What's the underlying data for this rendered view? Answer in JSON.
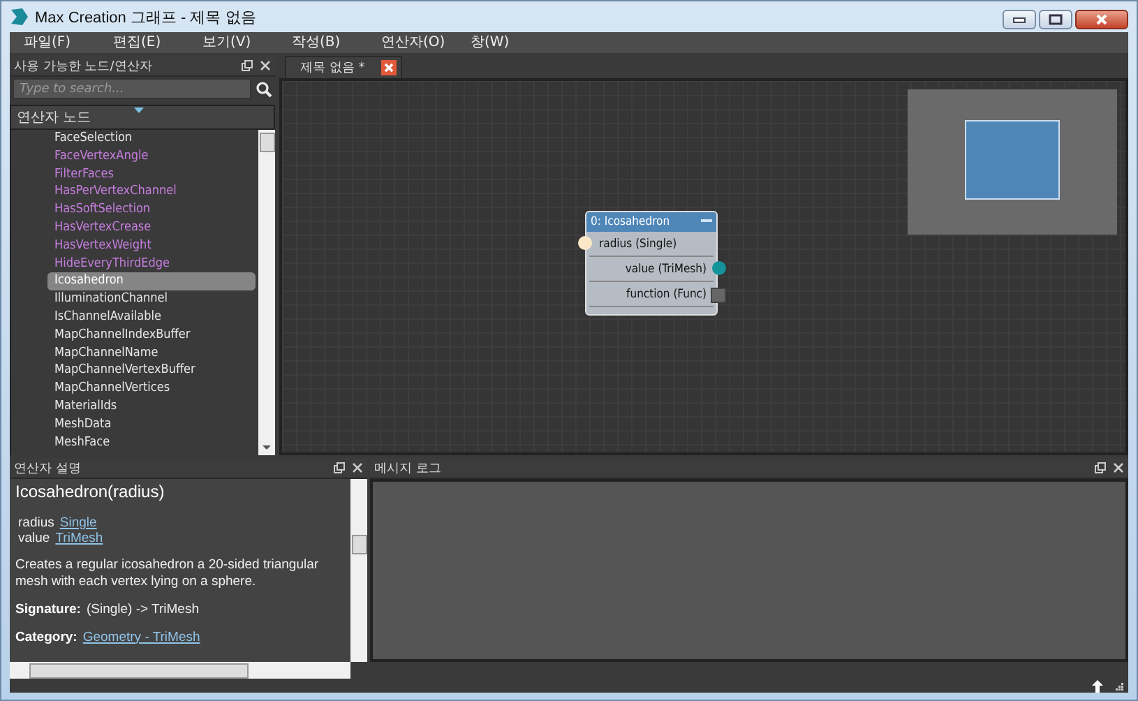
{
  "window": {
    "title": "Max Creation 그래프 - 제목 없음"
  },
  "menu": [
    "파일(F)",
    "편집(E)",
    "보기(V)",
    "작성(B)",
    "연산자(O)",
    "창(W)"
  ],
  "nodes_panel": {
    "title": "사용 가능한 노드/연산자",
    "search": {
      "placeholder": "Type to search..."
    },
    "group": "연산자 노드",
    "items": [
      {
        "label": "FaceSelection",
        "color": "#e8e8e8",
        "selected": false
      },
      {
        "label": "FaceVertexAngle",
        "color": "#c77ee0",
        "selected": false
      },
      {
        "label": "FilterFaces",
        "color": "#c77ee0",
        "selected": false
      },
      {
        "label": "HasPerVertexChannel",
        "color": "#c77ee0",
        "selected": false
      },
      {
        "label": "HasSoftSelection",
        "color": "#c77ee0",
        "selected": false
      },
      {
        "label": "HasVertexCrease",
        "color": "#c77ee0",
        "selected": false
      },
      {
        "label": "HasVertexWeight",
        "color": "#c77ee0",
        "selected": false
      },
      {
        "label": "HideEveryThirdEdge",
        "color": "#c77ee0",
        "selected": false
      },
      {
        "label": "Icosahedron",
        "color": "#ffffff",
        "selected": true
      },
      {
        "label": "IlluminationChannel",
        "color": "#e8e8e8",
        "selected": false
      },
      {
        "label": "IsChannelAvailable",
        "color": "#e8e8e8",
        "selected": false
      },
      {
        "label": "MapChannelIndexBuffer",
        "color": "#e8e8e8",
        "selected": false
      },
      {
        "label": "MapChannelName",
        "color": "#e8e8e8",
        "selected": false
      },
      {
        "label": "MapChannelVertexBuffer",
        "color": "#e8e8e8",
        "selected": false
      },
      {
        "label": "MapChannelVertices",
        "color": "#e8e8e8",
        "selected": false
      },
      {
        "label": "MaterialIds",
        "color": "#e8e8e8",
        "selected": false
      },
      {
        "label": "MeshData",
        "color": "#e8e8e8",
        "selected": false
      },
      {
        "label": "MeshFace",
        "color": "#e8e8e8",
        "selected": false
      }
    ]
  },
  "document_tab": {
    "label": "제목 없음 *"
  },
  "node": {
    "title": "0: Icosahedron",
    "ports": [
      {
        "label": "radius (Single)",
        "kind": "input"
      },
      {
        "label": "value (TriMesh)",
        "kind": "output"
      },
      {
        "label": "function (Func)",
        "kind": "function"
      }
    ]
  },
  "description_panel": {
    "title": "연산자 설명",
    "heading": "Icosahedron(radius)",
    "params": [
      {
        "name": "radius",
        "type": "Single"
      },
      {
        "name": "value",
        "type": "TriMesh"
      }
    ],
    "text": "Creates a regular icosahedron a 20-sided triangular mesh with each vertex lying on a sphere.",
    "signature_label": "Signature:",
    "signature": "(Single) -> TriMesh",
    "category_label": "Category:",
    "category": "Geometry - TriMesh"
  },
  "log_panel": {
    "title": "메시지 로그"
  }
}
